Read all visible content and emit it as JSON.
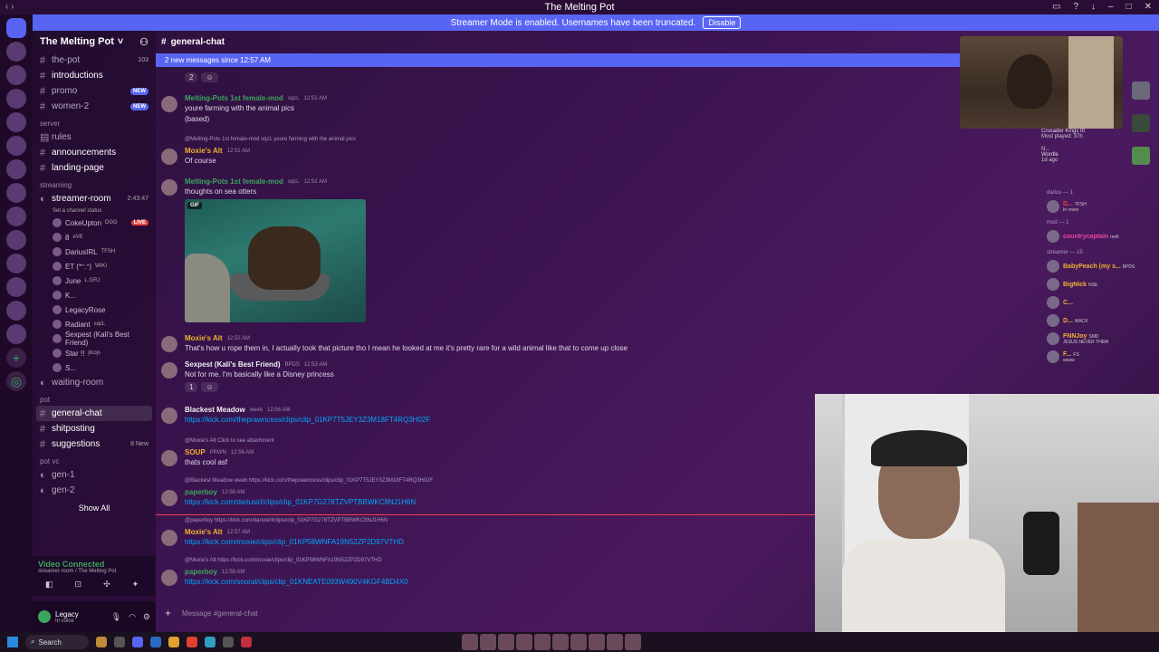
{
  "window": {
    "title": "The Melting Pot"
  },
  "banner": {
    "text": "Streamer Mode is enabled. Usernames have been truncated.",
    "button": "Disable"
  },
  "server": {
    "name": "The Melting Pot"
  },
  "channels": {
    "top": [
      {
        "name": "the-pot",
        "count": "103"
      },
      {
        "name": "introductions"
      },
      {
        "name": "promo",
        "badge": "NEW"
      },
      {
        "name": "women-2",
        "badge": "NEW"
      }
    ],
    "server_cat": "server",
    "server": [
      {
        "name": "rules"
      },
      {
        "name": "announcements"
      },
      {
        "name": "landing-page"
      }
    ],
    "streaming_cat": "streaming",
    "streamer_room": {
      "name": "streamer-room",
      "time": "2:43:47",
      "status": "Set a channel status"
    },
    "voice_users": [
      {
        "name": "CokeUpton",
        "tag": "DGG",
        "live": "LIVE"
      },
      {
        "name": "8",
        "tag": "eVE"
      },
      {
        "name": "DariusIRL",
        "tag": "TFSH"
      },
      {
        "name": "ET (*ᵔ.ᵔ)",
        "tag": "WIKI"
      },
      {
        "name": "June",
        "tag": "L.GRJ"
      },
      {
        "name": "K..."
      },
      {
        "name": "LegacyRose"
      },
      {
        "name": "Radiant",
        "tag": "sqcL"
      },
      {
        "name": "Sexpest (Kali's Best Friend)"
      },
      {
        "name": "Star !!",
        "tag": "jtcojs"
      },
      {
        "name": "S..."
      }
    ],
    "waiting_room": "waiting-room",
    "pot_cat": "pot",
    "pot": [
      {
        "name": "general-chat"
      },
      {
        "name": "shitposting"
      },
      {
        "name": "suggestions",
        "count": "8 New"
      }
    ],
    "potvc_cat": "pot vc",
    "potvc": [
      {
        "name": "gen-1"
      },
      {
        "name": "gen-2"
      }
    ],
    "show_all": "Show All"
  },
  "voice_panel": {
    "title": "Video Connected",
    "sub": "streamer-room / The Melting Pot"
  },
  "user_panel": {
    "name": "Legacy",
    "sub": "In voice"
  },
  "chat": {
    "channel": "general-chat",
    "new_messages": "2 new messages since 12:57 AM",
    "top_reaction": "2",
    "messages": [
      {
        "author": "Melting-Pots 1st female-mod",
        "tag": "sqcL",
        "time": "12:51 AM",
        "lines": [
          "youre farming with the animal pics",
          "(based)"
        ]
      },
      {
        "reply": "@Melting-Pots 1st female-mod  sqcL  youre farming with the animal pics",
        "author": "Moxie's Alt",
        "time": "12:51 AM",
        "lines": [
          "Of course"
        ]
      },
      {
        "author": "Melting-Pots 1st female-mod",
        "tag": "sqcL",
        "time": "12:52 AM",
        "lines": [
          "thoughts on sea otters"
        ],
        "gif": "GIF"
      },
      {
        "author": "Moxie's Alt",
        "time": "12:52 AM",
        "lines": [
          "That's how u rope them in, I actually took that picture tho I mean he looked at me it's pretty rare for a wild animal like that to come up close"
        ]
      },
      {
        "author": "Sexpest (Kali's Best Friend)",
        "tag": "BPDS",
        "time": "12:53 AM",
        "lines": [
          "Not for me. I'm basically like a Disney princess"
        ],
        "reaction": "1"
      },
      {
        "author": "Blackest Meadow",
        "tag": "weeb",
        "time": "12:56 AM",
        "lines": [
          "https://kick.com/theprawncess/clips/clip_01KP7T5JEY3Z3M18FT4RQ3H02F"
        ]
      },
      {
        "reply": "@Moxie's Alt  Click to see attachment",
        "author": "SOUP",
        "tag": "PRWN",
        "time": "12:56 AM",
        "lines": [
          "thats cool asf"
        ]
      },
      {
        "reply": "@Blackest Meadow  weeb  https://kick.com/theprawncess/clips/clip_01KP7T5JEY3Z3M18FT4RQ3H02F",
        "author": "paperboy",
        "time": "12:56 AM",
        "lines": [
          "https://kick.com/dariusirl/clips/clip_01KP7G278TZVPTBBWKC8NJ1H6N"
        ]
      },
      {
        "reply": "@paperboy  https://kick.com/dariusirl/clips/clip_01KP7G278TZVPTBBWKC8NJ1H6N",
        "author": "Moxie's Alt",
        "time": "12:57 AM",
        "lines": [
          "https://kick.com/moxie/clips/clip_01KP58WNFA19N52ZP2D97VTHD"
        ]
      },
      {
        "reply": "@Moxie's Alt  https://kick.com/moxie/clips/clip_01KP58WNFA19N52ZP2D97VTHD",
        "author": "paperboy",
        "time": "12:58 AM",
        "lines": [
          "https://kick.com/snoral/clips/clip_01KNEATE093W490V4KGF4BD4X0"
        ]
      }
    ],
    "composer_placeholder": "Message #general-chat"
  },
  "activity": {
    "game": "Crusader Kings III",
    "played": "Most played: 37h",
    "wordle": "Wordle",
    "wordle_sub": "1d ago",
    "n": "N..."
  },
  "members": [
    {
      "cat": "darius — 1",
      "users": [
        {
          "name": "D...",
          "tag": "TFSH",
          "sub": "In voice",
          "color": "#ed4245"
        }
      ]
    },
    {
      "cat": "mod — 1",
      "users": [
        {
          "name": "countrycaptain",
          "tag": "melt",
          "color": "#eb459e"
        }
      ]
    },
    {
      "cat": "streamer — 15",
      "users": [
        {
          "name": "BabyPeach (my s...",
          "tag": "BPDS",
          "color": "#f0b232"
        },
        {
          "name": "BigNick",
          "tag": "NSE",
          "color": "#f0b232"
        },
        {
          "name": "C...",
          "color": "#f0b232"
        },
        {
          "name": "D...",
          "tag": "WACK",
          "color": "#f0b232"
        },
        {
          "name": "FNNJoy",
          "tag": "SMD",
          "sub": "JESUS NEVER THEM",
          "color": "#f0b232"
        },
        {
          "name": "F...",
          "tag": "FS",
          "sub": "woaw",
          "color": "#f0b232"
        }
      ]
    }
  ],
  "taskbar": {
    "search": "Search"
  }
}
